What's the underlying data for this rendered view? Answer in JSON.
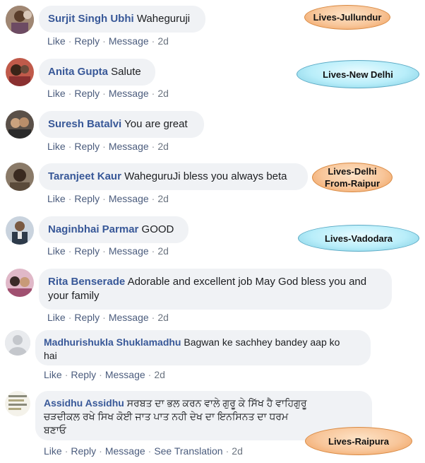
{
  "comments": [
    {
      "name": "Surjit Singh Ubhi",
      "text": "Waheguruji",
      "actions": {
        "like": "Like",
        "reply": "Reply",
        "message": "Message",
        "time": "2d"
      }
    },
    {
      "name": "Anita Gupta",
      "text": "Salute",
      "actions": {
        "like": "Like",
        "reply": "Reply",
        "message": "Message",
        "time": "2d"
      }
    },
    {
      "name": "Suresh Batalvi",
      "text": "You are great",
      "actions": {
        "like": "Like",
        "reply": "Reply",
        "message": "Message",
        "time": "2d"
      }
    },
    {
      "name": "Taranjeet Kaur",
      "text": "WaheguruJi bless you always beta",
      "actions": {
        "like": "Like",
        "reply": "Reply",
        "message": "Message",
        "time": "2d"
      }
    },
    {
      "name": "Naginbhai Parmar",
      "text": "GOOD",
      "actions": {
        "like": "Like",
        "reply": "Reply",
        "message": "Message",
        "time": "2d"
      }
    },
    {
      "name": "Rita Benserade",
      "text": "Adorable and excellent job May God bless you and",
      "text2": "your family",
      "actions": {
        "like": "Like",
        "reply": "Reply",
        "message": "Message",
        "time": "2d"
      }
    },
    {
      "name": "Madhurishukla Shuklamadhu",
      "text": "Bagwan ke sachhey bandey aap ko",
      "text2": "hai",
      "actions": {
        "like": "Like",
        "reply": "Reply",
        "message": "Message",
        "time": "2d"
      }
    },
    {
      "name": "Assidhu Assidhu",
      "text": "ਸਰਬਤ ਦਾ ਭਲ ਕਰਨ ਵਾਲੇ ਗੁਰੂ ਕੇ ਸਿੱਖ ਹੈ ਵਾਹਿਗੁਰੂ",
      "text2": "ਚੜਦੀਕਲ ਰਖੇ ਸਿਖ ਕੋਈ ਜਾਤ ਪਾਤ ਨਹੀ ਦੇਖ ਦਾ ਇਨਸਿਨਤ ਦਾ ਧਰਮ",
      "text3": "ਬਣਾਓ",
      "actions": {
        "like": "Like",
        "reply": "Reply",
        "message": "Message",
        "translation": "See Translation",
        "time": "2d"
      }
    }
  ],
  "tags": {
    "jullundur": "Lives-Jullundur",
    "new_delhi": "Lives-New Delhi",
    "delhi_1": "Lives-Delhi",
    "delhi_2": "From-Raipur",
    "vadodara": "Lives-Vadodara",
    "raipura": "Lives-Raipura"
  },
  "colors": {
    "name": "#385898",
    "bubble": "#f0f2f5",
    "action": "#4b5c7d",
    "tag_orange": "#f8c69a",
    "tag_blue": "#b9eefa"
  }
}
